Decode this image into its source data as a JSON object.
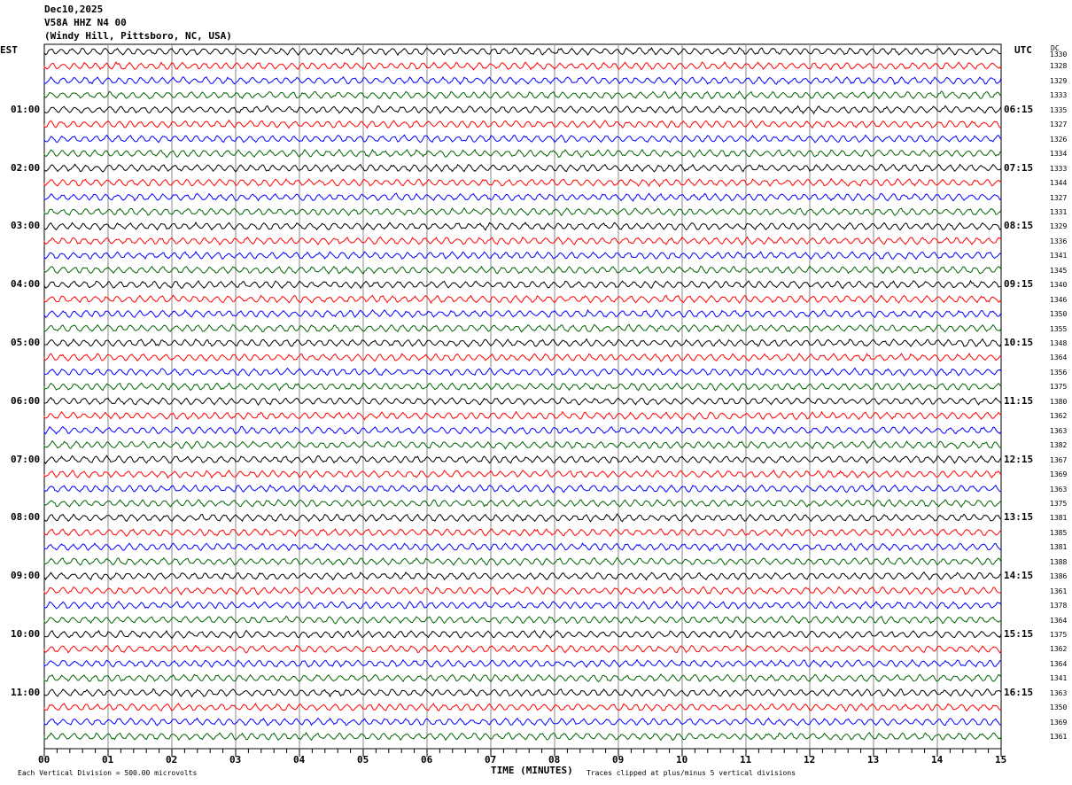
{
  "header": {
    "date": "Dec10,2025",
    "station": "V58A HHZ N4 00",
    "location": "(Windy Hill, Pittsboro, NC, USA)"
  },
  "chart_data": {
    "type": "line",
    "left_timezone": "EST",
    "right_timezone": "UTC",
    "dc_label": "DC",
    "left_hour_labels": [
      "01:00",
      "02:00",
      "03:00",
      "04:00",
      "05:00",
      "06:00",
      "07:00",
      "08:00",
      "09:00",
      "10:00",
      "11:00"
    ],
    "right_hour_labels": [
      "06:15",
      "07:15",
      "08:15",
      "09:15",
      "10:15",
      "11:15",
      "12:15",
      "13:15",
      "14:15",
      "15:15",
      "16:15"
    ],
    "dc_offsets": [
      "1330",
      "1328",
      "1329",
      "1333",
      "1335",
      "1327",
      "1326",
      "1334",
      "1333",
      "1344",
      "1327",
      "1331",
      "1329",
      "1336",
      "1341",
      "1345",
      "1340",
      "1346",
      "1350",
      "1355",
      "1348",
      "1364",
      "1356",
      "1375",
      "1380",
      "1362",
      "1363",
      "1382",
      "1367",
      "1369",
      "1363",
      "1375",
      "1381",
      "1385",
      "1381",
      "1388",
      "1386",
      "1361",
      "1378",
      "1364",
      "1375",
      "1362",
      "1364",
      "1341",
      "1363",
      "1350",
      "1369",
      "1361"
    ],
    "trace_colors": [
      "#000000",
      "#ff0000",
      "#0000ff",
      "#006400"
    ],
    "x_ticks": [
      "00",
      "01",
      "02",
      "03",
      "04",
      "05",
      "06",
      "07",
      "08",
      "09",
      "10",
      "11",
      "12",
      "13",
      "14",
      "15"
    ],
    "xlim": [
      0,
      15
    ],
    "xlabel": "TIME (MINUTES)",
    "grid": true,
    "scale_note": "Each Vertical Division =  500.00 microvolts",
    "clip_note": "Traces clipped at plus/minus 5 vertical divisions"
  }
}
